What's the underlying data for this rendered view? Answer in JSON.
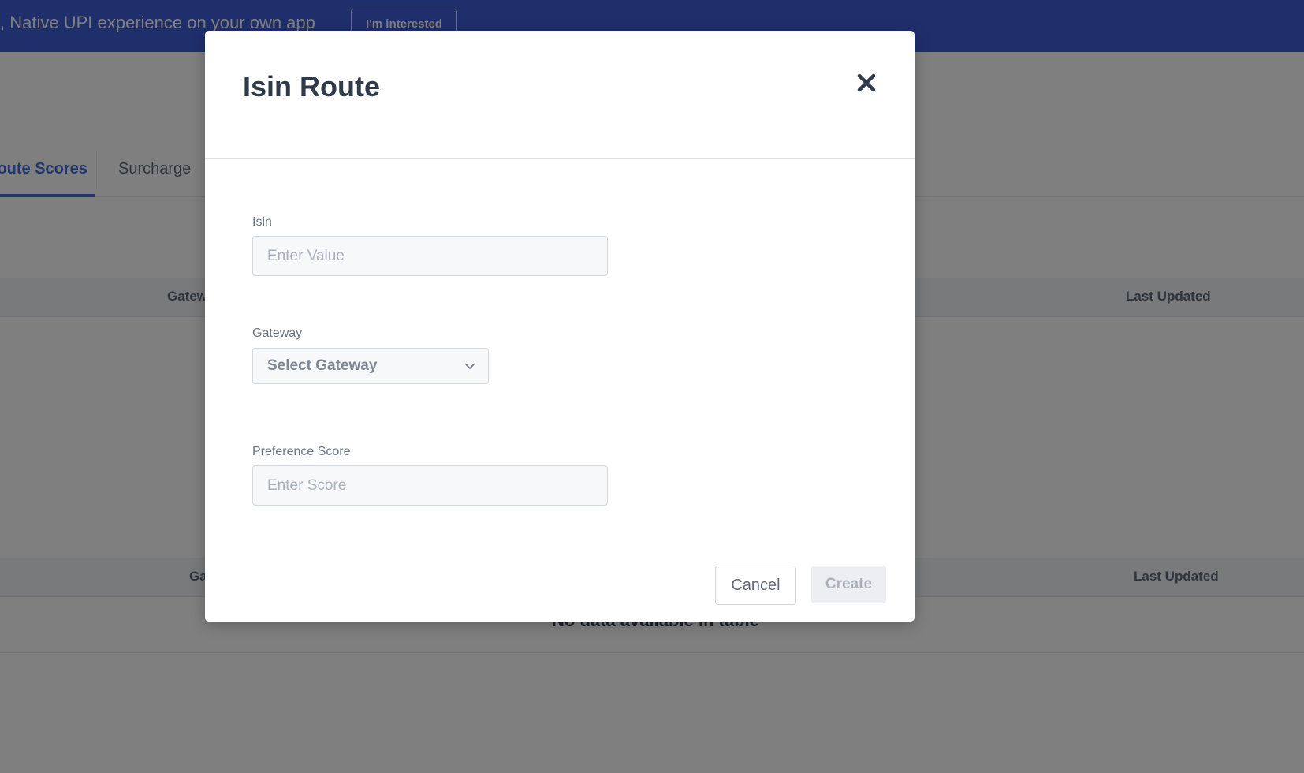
{
  "banner": {
    "text": ", Native UPI experience on your own app",
    "button_label": "I'm interested"
  },
  "tabs": [
    {
      "label": "Route Scores",
      "active": true
    },
    {
      "label": "Surcharge",
      "active": false
    }
  ],
  "table_top": {
    "headers": [
      "Gateway",
      "Last Updated"
    ]
  },
  "table_bottom": {
    "headers": [
      "Gateway",
      "Last Updated"
    ],
    "empty_text": "No data available in table"
  },
  "modal": {
    "title": "Isin Route",
    "fields": {
      "isin": {
        "label": "Isin",
        "placeholder": "Enter Value",
        "value": ""
      },
      "gateway": {
        "label": "Gateway",
        "placeholder": "Select Gateway"
      },
      "preference_score": {
        "label": "Preference Score",
        "placeholder": "Enter Score",
        "value": ""
      }
    },
    "buttons": {
      "cancel": "Cancel",
      "create": "Create"
    }
  },
  "colors": {
    "banner_bg": "#3e5fd9",
    "overlay": "rgba(0,0,0,0.5)",
    "title": "#2f3b4a",
    "accent": "#3e73e0"
  },
  "icons": {
    "close": "close-icon",
    "dropdown": "chevron-down-icon"
  }
}
